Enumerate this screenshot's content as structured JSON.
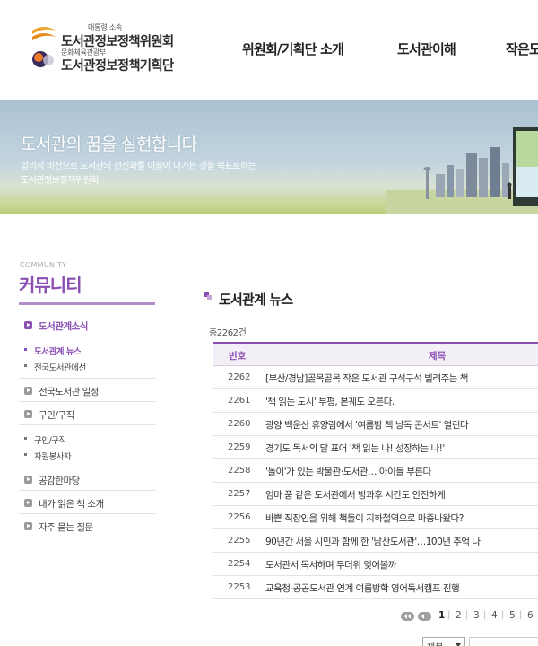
{
  "header": {
    "logo": {
      "org1_small": "대통령 소속",
      "org1_name": "도서관정보정책위원회",
      "org2_small": "문화체육관광부",
      "org2_name": "도서관정보정책기획단"
    },
    "nav": [
      {
        "label": "위원회/기획단 소개"
      },
      {
        "label": "도서관이해"
      },
      {
        "label": "작은도"
      }
    ]
  },
  "banner": {
    "title": "도서관의 꿈을 실현합니다",
    "subtitle_line1": "합리적 비전으로 도서관의 선진화를 이끌어 나가는 것을 목표로하는",
    "subtitle_line2": "도서관정보정책위원회"
  },
  "sidebar": {
    "eyebrow": "COMMUNITY",
    "title": "커뮤니티",
    "menu": [
      {
        "label": "도서관계소식",
        "active": true,
        "sub": [
          {
            "label": "도서관계 뉴스",
            "active": true
          },
          {
            "label": "전국도서관에선",
            "active": false
          }
        ]
      },
      {
        "label": "전국도서관 일정",
        "active": false
      },
      {
        "label": "구인/구직",
        "active": false,
        "sub": [
          {
            "label": "구인/구직",
            "active": false
          },
          {
            "label": "자원봉사자",
            "active": false
          }
        ]
      },
      {
        "label": "공감한마당",
        "active": false
      },
      {
        "label": "내가 읽은 책 소개",
        "active": false
      },
      {
        "label": "자주 묻는 질문",
        "active": false
      }
    ]
  },
  "main": {
    "title": "도서관계 뉴스",
    "total": "총2262건",
    "table": {
      "columns": {
        "no": "번호",
        "subject": "제목"
      },
      "rows": [
        {
          "no": "2262",
          "subject": "[부산/경남]골목골목 작은 도서관 구석구석 빌려주는 책"
        },
        {
          "no": "2261",
          "subject": "'책 읽는 도시' 부평, 본궤도 오른다."
        },
        {
          "no": "2260",
          "subject": "광양 백운산 휴양림에서 '여름밤 책 낭독 콘서트' 열린다"
        },
        {
          "no": "2259",
          "subject": "경기도 독서의 달 표어 '책 읽는 나! 성장하는 나!'"
        },
        {
          "no": "2258",
          "subject": "'놀이'가 있는 박물관·도서관… 아이들 부른다"
        },
        {
          "no": "2257",
          "subject": "엄마 품 같은 도서관에서 방과후 시간도 안전하게"
        },
        {
          "no": "2256",
          "subject": "바쁜 직장인을 위해 책들이 지하철역으로 마중나왔다?"
        },
        {
          "no": "2255",
          "subject": "90년간 서울 시민과 함께 한 '남산도서관'…100년 추억 나"
        },
        {
          "no": "2254",
          "subject": "도서관서 독서하며 무더위 잊어볼까"
        },
        {
          "no": "2253",
          "subject": "교육청-공공도서관 연계 여름방학 영어독서캠프 진행"
        }
      ]
    },
    "pagination": {
      "pages": [
        "1",
        "2",
        "3",
        "4",
        "5",
        "6"
      ],
      "current": "1"
    },
    "search": {
      "field_selected": "제목"
    }
  },
  "colors": {
    "accent": "#8b4fb3",
    "header_row_bg": "#f3eff6"
  }
}
